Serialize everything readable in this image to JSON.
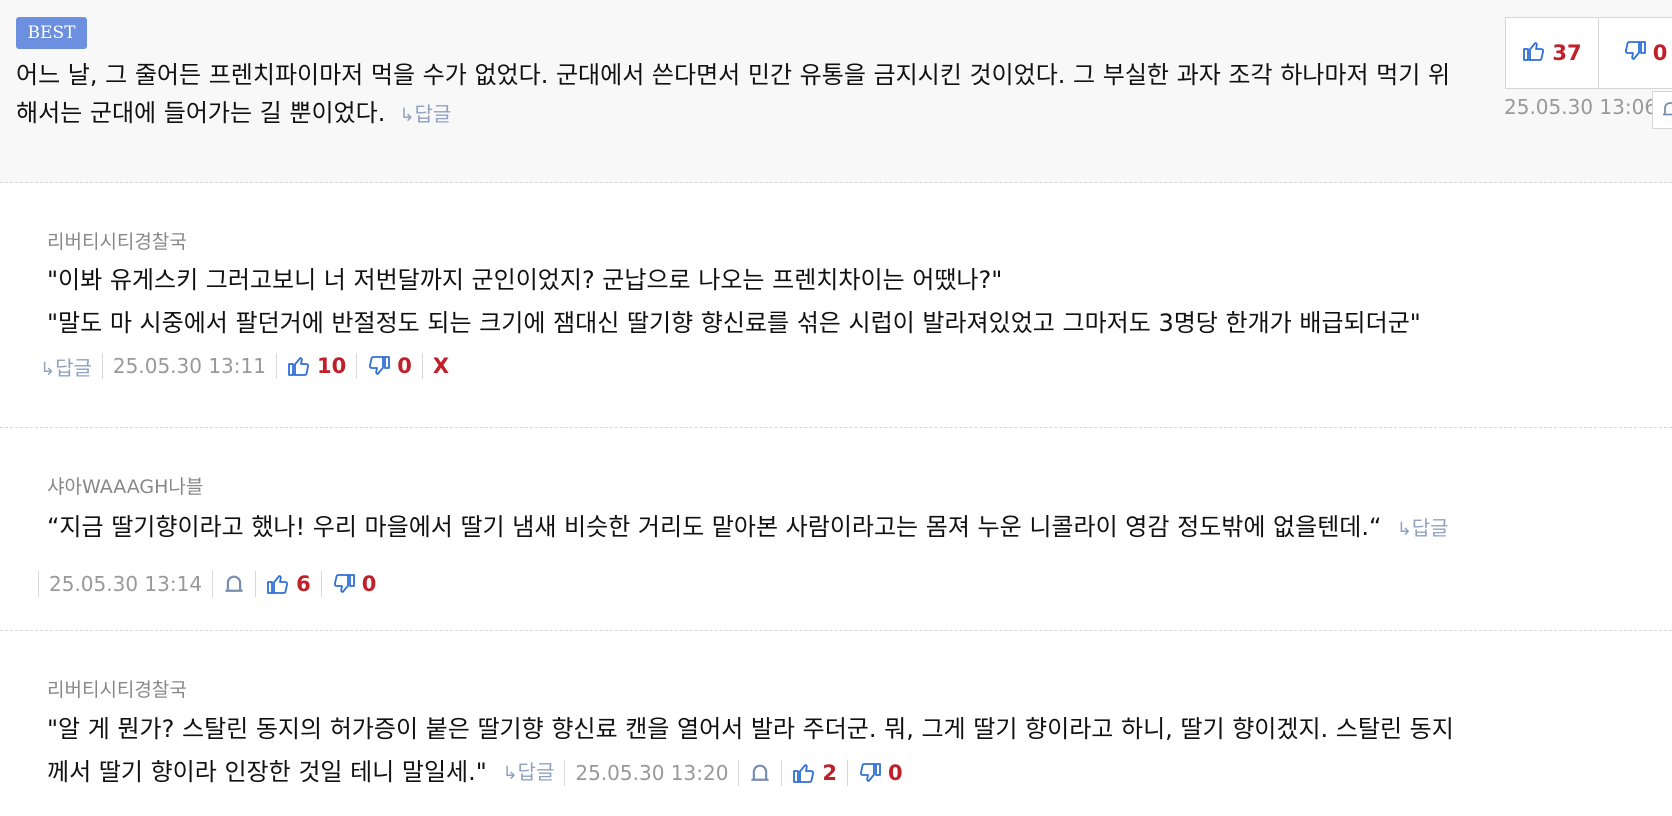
{
  "best": {
    "badge": "BEST",
    "text": "어느 날, 그 줄어든 프렌치파이마저 먹을 수가 없었다. 군대에서 쓴다면서 민간 유통을 금지시킨 것이었다. 그 부실한 과자 조각 하나마저 먹기 위해서는 군대에 들어가는 길 뿐이었다.",
    "reply_label": "답글",
    "likes": "37",
    "dislikes": "0",
    "date": "25.05.30 13:06"
  },
  "comments": [
    {
      "author": "리버티시티경찰국",
      "lines": [
        "\"이봐 유게스키 그러고보니 너 저번달까지 군인이었지? 군납으로 나오는 프렌치차이는 어땠나?\"",
        "\"말도 마 시중에서 팔던거에 반절정도 되는 크기에 잼대신 딸기향 향신료를 섞은 시럽이 발라져있었고 그마저도 3명당 한개가 배급되더군\""
      ],
      "reply_label": "답글",
      "date": "25.05.30 13:11",
      "likes": "10",
      "dislikes": "0",
      "delete_label": "X"
    },
    {
      "author": "샤아WAAAGH나블",
      "lines": [
        "“지금 딸기향이라고 했나! 우리 마을에서 딸기 냄새 비슷한 거리도 맡아본 사람이라고는 몸져 누운 니콜라이 영감 정도밖에 없을텐데.“"
      ],
      "reply_label": "답글",
      "date": "25.05.30 13:14",
      "likes": "6",
      "dislikes": "0"
    },
    {
      "author": "리버티시티경찰국",
      "lines": [
        "\"알 게 뭔가? 스탈린 동지의 허가증이 붙은 딸기향 향신료 캔을 열어서 발라 주더군. 뭐, 그게 딸기 향이라고 하니, 딸기 향이겠지. 스탈린 동지",
        "께서 딸기 향이라 인장한 것일 테니 말일세.\""
      ],
      "reply_label": "답글",
      "date": "25.05.30 13:20",
      "likes": "2",
      "dislikes": "0"
    }
  ],
  "colors": {
    "accent": "#6c8fe0",
    "vote_number": "#c0202a",
    "icon": "#2f6fd6",
    "muted": "#999999"
  },
  "icons": [
    "thumbs-up-icon",
    "thumbs-down-icon",
    "report-bell-icon",
    "reply-arrow-icon"
  ]
}
